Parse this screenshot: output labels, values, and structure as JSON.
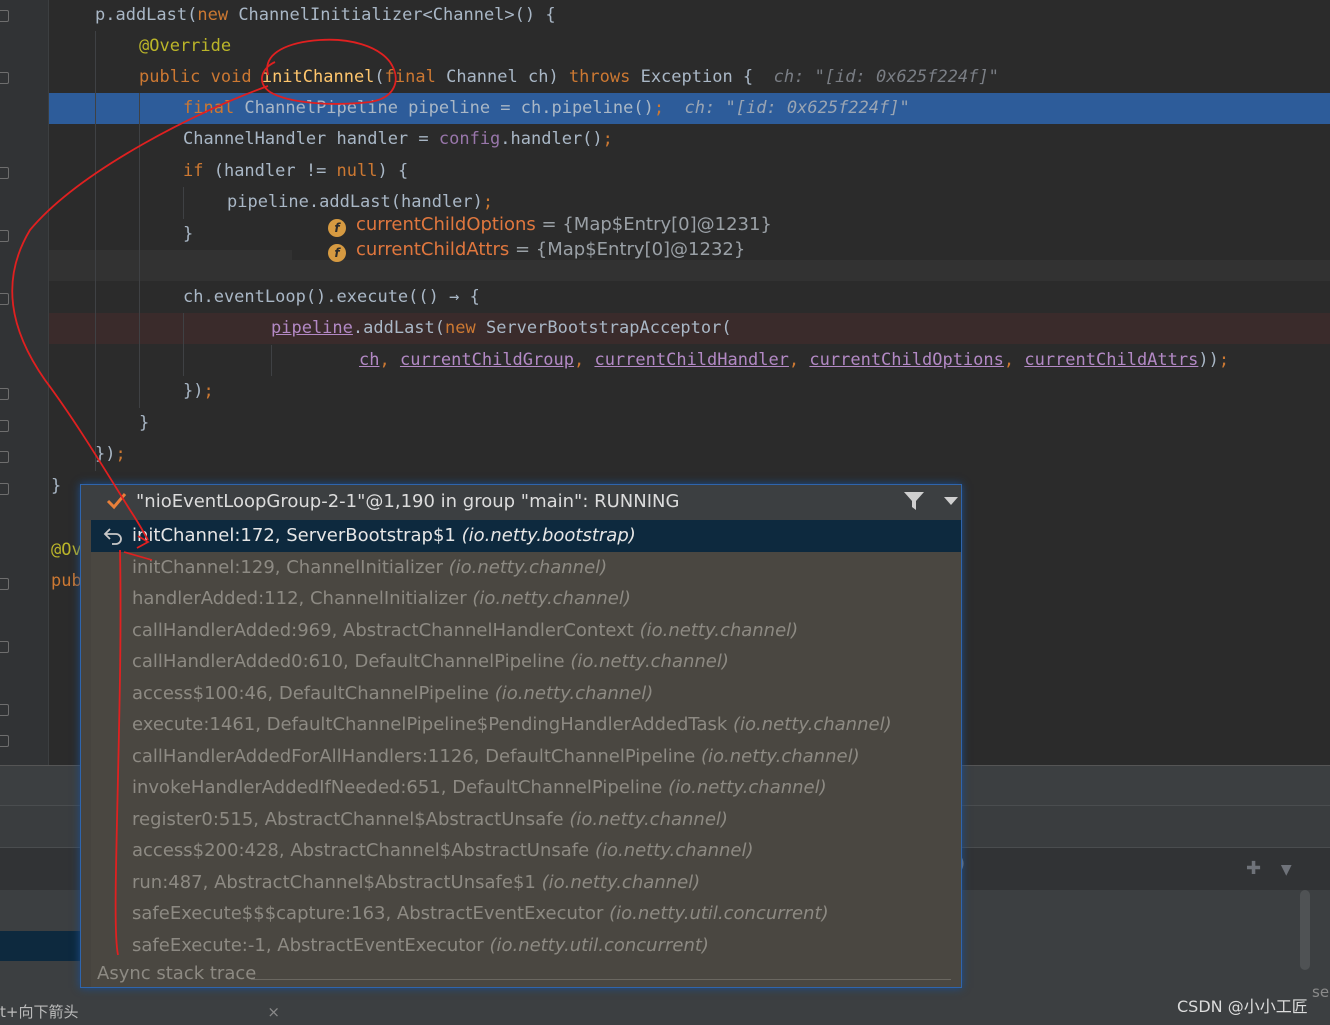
{
  "editor": {
    "lines": [
      {
        "segments": [
          {
            "t": "p.addLast(",
            "c": ""
          },
          {
            "t": "new ",
            "c": "kw"
          },
          {
            "t": "ChannelInitializer<Channel>() {",
            "c": ""
          }
        ]
      },
      {
        "segments": [
          {
            "t": "@Override",
            "c": "ann"
          }
        ]
      },
      {
        "segments": [
          {
            "t": "public void ",
            "c": "kw"
          },
          {
            "t": "initChannel",
            "c": "fn"
          },
          {
            "t": "(",
            "c": ""
          },
          {
            "t": "final ",
            "c": "kw"
          },
          {
            "t": "Channel ch) ",
            "c": ""
          },
          {
            "t": "throws ",
            "c": "kw"
          },
          {
            "t": "Exception {  ",
            "c": ""
          },
          {
            "t": "ch: \"[id: 0x625f224f]\"",
            "c": "hint"
          }
        ]
      },
      {
        "segments": [
          {
            "t": "final ",
            "c": "kw"
          },
          {
            "t": "ChannelPipeline pipeline = ch.pipeline()",
            "c": ""
          },
          {
            "t": ";  ",
            "c": "kw"
          },
          {
            "t": "ch: \"[id: 0x625f224f]\"",
            "c": "hint"
          }
        ]
      },
      {
        "segments": [
          {
            "t": "ChannelHandler handler = ",
            "c": ""
          },
          {
            "t": "config",
            "c": "fld"
          },
          {
            "t": ".handler()",
            "c": ""
          },
          {
            "t": ";",
            "c": "kw"
          }
        ]
      },
      {
        "segments": [
          {
            "t": "if ",
            "c": "kw"
          },
          {
            "t": "(handler != ",
            "c": ""
          },
          {
            "t": "null",
            "c": "kw"
          },
          {
            "t": ") {",
            "c": ""
          }
        ]
      },
      {
        "segments": [
          {
            "t": "pipeline.addLast(handler)",
            "c": ""
          },
          {
            "t": ";",
            "c": "kw"
          }
        ]
      },
      {
        "segments": [
          {
            "t": "}",
            "c": ""
          }
        ]
      },
      {
        "segments": []
      },
      {
        "segments": [
          {
            "t": "ch.eventLoop().execute(() → {",
            "c": ""
          }
        ]
      },
      {
        "segments": [
          {
            "t": "pipeline",
            "c": "ul"
          },
          {
            "t": ".addLast(",
            "c": ""
          },
          {
            "t": "new ",
            "c": "kw"
          },
          {
            "t": "ServerBootstrapAcceptor(",
            "c": ""
          }
        ]
      },
      {
        "segments": [
          {
            "t": "ch",
            "c": "ul"
          },
          {
            "t": ", ",
            "c": "kw"
          },
          {
            "t": "currentChildGroup",
            "c": "ul"
          },
          {
            "t": ", ",
            "c": "kw"
          },
          {
            "t": "currentChildHandler",
            "c": "ul"
          },
          {
            "t": ", ",
            "c": "kw"
          },
          {
            "t": "currentChildOptions",
            "c": "ul"
          },
          {
            "t": ", ",
            "c": "kw"
          },
          {
            "t": "currentChildAttrs",
            "c": "ul"
          },
          {
            "t": "))",
            "c": ""
          },
          {
            "t": ";",
            "c": "kw"
          }
        ]
      },
      {
        "segments": [
          {
            "t": "})",
            "c": ""
          },
          {
            "t": ";",
            "c": "kw"
          }
        ]
      },
      {
        "segments": [
          {
            "t": "}",
            "c": ""
          }
        ]
      },
      {
        "segments": [
          {
            "t": "})",
            "c": ""
          },
          {
            "t": ";",
            "c": "kw"
          }
        ]
      },
      {
        "segments": [
          {
            "t": "}",
            "c": ""
          }
        ]
      },
      {
        "segments": [
          {
            "t": "@Ov",
            "c": "ann"
          }
        ]
      },
      {
        "segments": [
          {
            "t": "pub",
            "c": "kw"
          }
        ]
      }
    ]
  },
  "popup": {
    "title": "\"nioEventLoopGroup-2-1\"@1,190 in group \"main\": RUNNING",
    "frames": [
      {
        "method": "initChannel:172, ServerBootstrap$1",
        "pkg": "(io.netty.bootstrap)"
      },
      {
        "method": "initChannel:129, ChannelInitializer",
        "pkg": "(io.netty.channel)"
      },
      {
        "method": "handlerAdded:112, ChannelInitializer",
        "pkg": "(io.netty.channel)"
      },
      {
        "method": "callHandlerAdded:969, AbstractChannelHandlerContext",
        "pkg": "(io.netty.channel)"
      },
      {
        "method": "callHandlerAdded0:610, DefaultChannelPipeline",
        "pkg": "(io.netty.channel)"
      },
      {
        "method": "access$100:46, DefaultChannelPipeline",
        "pkg": "(io.netty.channel)"
      },
      {
        "method": "execute:1461, DefaultChannelPipeline$PendingHandlerAddedTask",
        "pkg": "(io.netty.channel)"
      },
      {
        "method": "callHandlerAddedForAllHandlers:1126, DefaultChannelPipeline",
        "pkg": "(io.netty.channel)"
      },
      {
        "method": "invokeHandlerAddedIfNeeded:651, DefaultChannelPipeline",
        "pkg": "(io.netty.channel)"
      },
      {
        "method": "register0:515, AbstractChannel$AbstractUnsafe",
        "pkg": "(io.netty.channel)"
      },
      {
        "method": "access$200:428, AbstractChannel$AbstractUnsafe",
        "pkg": "(io.netty.channel)"
      },
      {
        "method": "run:487, AbstractChannel$AbstractUnsafe$1",
        "pkg": "(io.netty.channel)"
      },
      {
        "method": "safeExecute$$$capture:163, AbstractEventExecutor",
        "pkg": "(io.netty.util.concurrent)"
      },
      {
        "method": "safeExecute:-1, AbstractEventExecutor",
        "pkg": "(io.netty.util.concurrent)"
      }
    ],
    "async_label": "Async stack trace"
  },
  "variables": [
    {
      "icon": "f",
      "name": "currentChildOptions",
      "value": "= {Map$Entry[0]@1231}"
    },
    {
      "icon": "f",
      "name": "currentChildAttrs",
      "value": "= {Map$Entry[0]@1232}"
    }
  ],
  "hint_bar": {
    "text": "t+向下箭头",
    "close": "×"
  },
  "right_fragment": ")",
  "right_edge_text": "se",
  "watermark": "CSDN @小小工匠",
  "colors": {
    "highlight": "#2d5c9a",
    "selected_frame": "#0d293e",
    "annotation": "#e02020",
    "keyword": "#cc7832"
  }
}
